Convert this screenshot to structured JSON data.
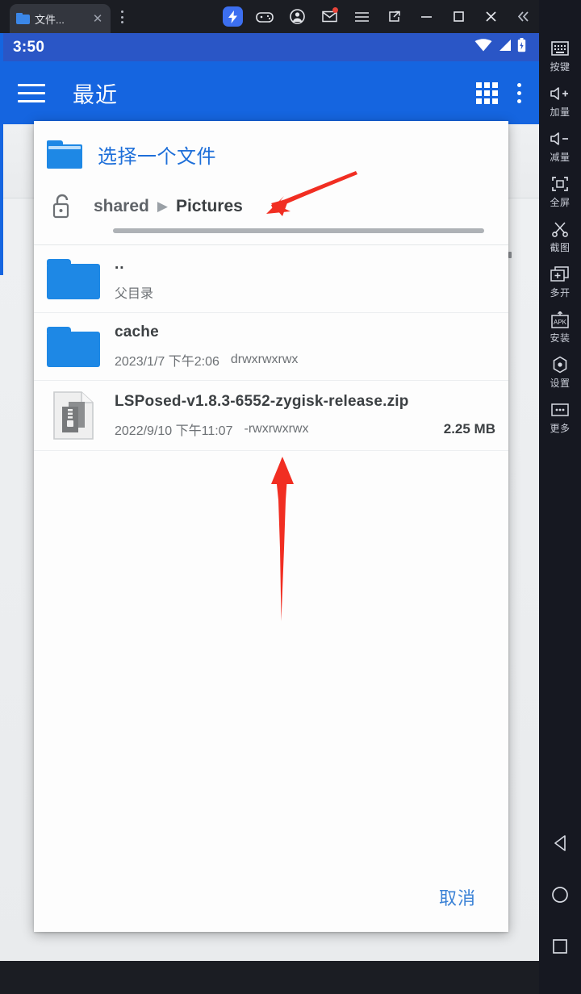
{
  "window": {
    "tab_title": "文件...",
    "tab_close_icon": "close-icon",
    "tab_menu_icon": "kebab-menu-icon",
    "controls": [
      {
        "name": "lightning-boost-icon",
        "label": "加速"
      },
      {
        "name": "gamepad-icon",
        "label": "游戏"
      },
      {
        "name": "account-icon",
        "label": "账号"
      },
      {
        "name": "mail-icon",
        "label": "消息",
        "badge": true
      },
      {
        "name": "menu-icon",
        "label": "菜单"
      },
      {
        "name": "restore-window-icon",
        "label": "还原"
      },
      {
        "name": "minimize-icon",
        "label": "最小化"
      },
      {
        "name": "maximize-icon",
        "label": "最大化"
      },
      {
        "name": "close-window-icon",
        "label": "关闭"
      },
      {
        "name": "collapse-sidebar-icon",
        "label": "收起"
      }
    ]
  },
  "phone": {
    "statusbar": {
      "clock": "3:50",
      "icons": [
        "wifi-icon",
        "signal-icon",
        "battery-icon"
      ]
    },
    "appbar": {
      "menu_icon": "hamburger-menu-icon",
      "title": "最近",
      "grid_icon": "grid-view-icon",
      "overflow_icon": "overflow-menu-icon"
    }
  },
  "dialog": {
    "title": "选择一个文件",
    "folder_icon": "folder-icon",
    "lock_icon": "unlock-icon",
    "breadcrumb": [
      {
        "label": "shared",
        "active": false
      },
      {
        "label": "Pictures",
        "active": true
      }
    ],
    "breadcrumb_separator": "▶",
    "files": [
      {
        "icon": "folder-icon",
        "name": "..",
        "meta_date": "父目录",
        "permissions": "",
        "size": ""
      },
      {
        "icon": "folder-icon",
        "name": "cache",
        "meta_date": "2023/1/7 下午2:06",
        "permissions": "drwxrwxrwx",
        "size": ""
      },
      {
        "icon": "zip-file-icon",
        "name": "LSPosed-v1.8.3-6552-zygisk-release.zip",
        "meta_date": "2022/9/10 下午11:07",
        "permissions": "-rwxrwxrwx",
        "size": "2.25 MB"
      }
    ],
    "cancel_label": "取消"
  },
  "sidebar": {
    "collapse_icon": "collapse-icon",
    "items": [
      {
        "icon": "keyboard-icon",
        "label": "按键"
      },
      {
        "icon": "volume-up-icon",
        "label": "加量"
      },
      {
        "icon": "volume-down-icon",
        "label": "减量"
      },
      {
        "icon": "fullscreen-icon",
        "label": "全屏"
      },
      {
        "icon": "scissors-screenshot-icon",
        "label": "截图"
      },
      {
        "icon": "multi-instance-icon",
        "label": "多开"
      },
      {
        "icon": "apk-install-icon",
        "label": "安装"
      },
      {
        "icon": "settings-icon",
        "label": "设置"
      },
      {
        "icon": "more-icon",
        "label": "更多"
      }
    ],
    "nav": [
      {
        "icon": "android-back-icon",
        "label": "返回"
      },
      {
        "icon": "android-home-icon",
        "label": "主页"
      },
      {
        "icon": "android-recents-icon",
        "label": "最近任务"
      }
    ]
  },
  "annotations": {
    "arrow_breadcrumb": "红色箭头指向 Pictures 路径",
    "arrow_permissions": "红色箭头指向 -rwxrwxrwx 权限",
    "color": "#f12e22"
  }
}
